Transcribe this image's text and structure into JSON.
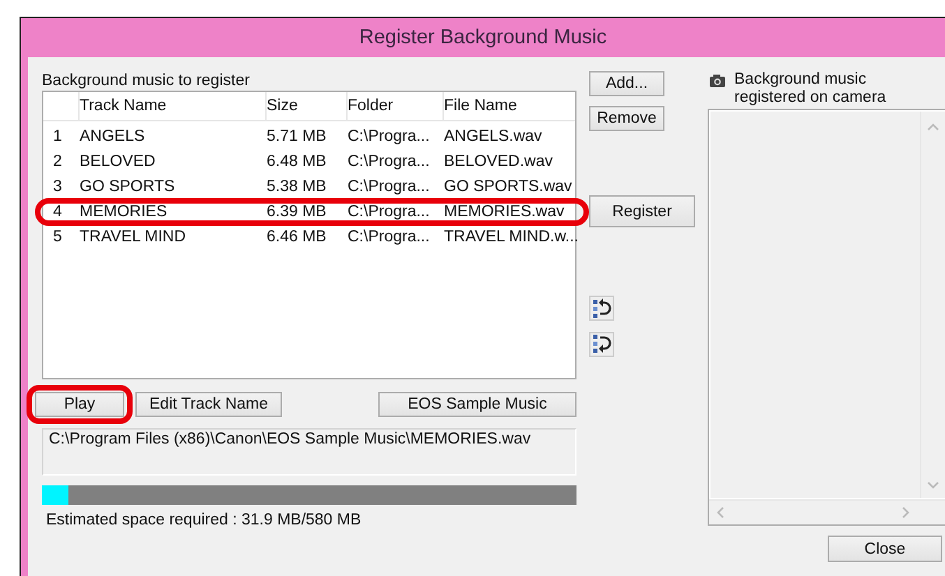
{
  "window": {
    "title": "Register Background Music"
  },
  "list_label": "Background music to register",
  "table": {
    "columns": [
      "Track Name",
      "Size",
      "Folder",
      "File Name"
    ],
    "rows": [
      {
        "number": "1",
        "track": "ANGELS",
        "size": "5.71 MB",
        "folder": "C:\\Progra...",
        "file": "ANGELS.wav",
        "annotated": false
      },
      {
        "number": "2",
        "track": "BELOVED",
        "size": "6.48 MB",
        "folder": "C:\\Progra...",
        "file": "BELOVED.wav",
        "annotated": false
      },
      {
        "number": "3",
        "track": "GO SPORTS",
        "size": "5.38 MB",
        "folder": "C:\\Progra...",
        "file": "GO SPORTS.wav",
        "annotated": false
      },
      {
        "number": "4",
        "track": "MEMORIES",
        "size": "6.39 MB",
        "folder": "C:\\Progra...",
        "file": "MEMORIES.wav",
        "annotated": true
      },
      {
        "number": "5",
        "track": "TRAVEL MIND",
        "size": "6.46 MB",
        "folder": "C:\\Progra...",
        "file": "TRAVEL MIND.w...",
        "annotated": false
      }
    ]
  },
  "side_buttons": {
    "add": "Add...",
    "remove": "Remove",
    "register": "Register"
  },
  "bottom_buttons": [
    {
      "label": "Play",
      "annotated": true
    },
    {
      "label": "Edit Track Name",
      "annotated": false
    },
    {
      "label": "EOS Sample Music",
      "annotated": false
    }
  ],
  "path": "C:\\Program Files (x86)\\Canon\\EOS Sample Music\\MEMORIES.wav",
  "space": {
    "level": 0.05,
    "text": "Estimated space required : 31.9 MB/580 MB"
  },
  "camera_label": "Background music registered on camera",
  "close": "Close"
}
